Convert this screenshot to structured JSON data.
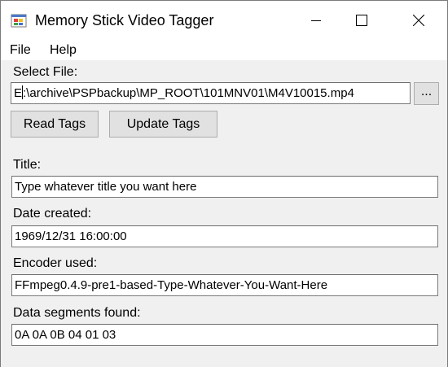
{
  "window": {
    "title": "Memory Stick Video Tagger"
  },
  "icons": {
    "app": "app-icon",
    "minimize": "minimize-icon",
    "maximize": "maximize-icon",
    "close": "close-icon"
  },
  "menu": {
    "file": "File",
    "help": "Help"
  },
  "file_select": {
    "label": "Select File:",
    "path": ":\\archive\\PSPbackup\\MP_ROOT\\101MNV01\\M4V10015.mp4",
    "path_prefix": "E",
    "browse_label": "..."
  },
  "buttons": {
    "read_tags": "Read Tags",
    "update_tags": "Update Tags"
  },
  "fields": {
    "title_label": "Title:",
    "title_value": "Type whatever title you want here",
    "date_label": "Date created:",
    "date_value": "1969/12/31 16:00:00",
    "encoder_label": "Encoder used:",
    "encoder_value": "FFmpeg0.4.9-pre1-based-Type-Whatever-You-Want-Here",
    "segments_label": "Data segments found:",
    "segments_value": "0A 0A 0B 04 01 03"
  },
  "colors": {
    "title_bar_bg": "#ffffff",
    "window_bg": "#f0f0f0",
    "button_bg": "#e1e1e1"
  }
}
